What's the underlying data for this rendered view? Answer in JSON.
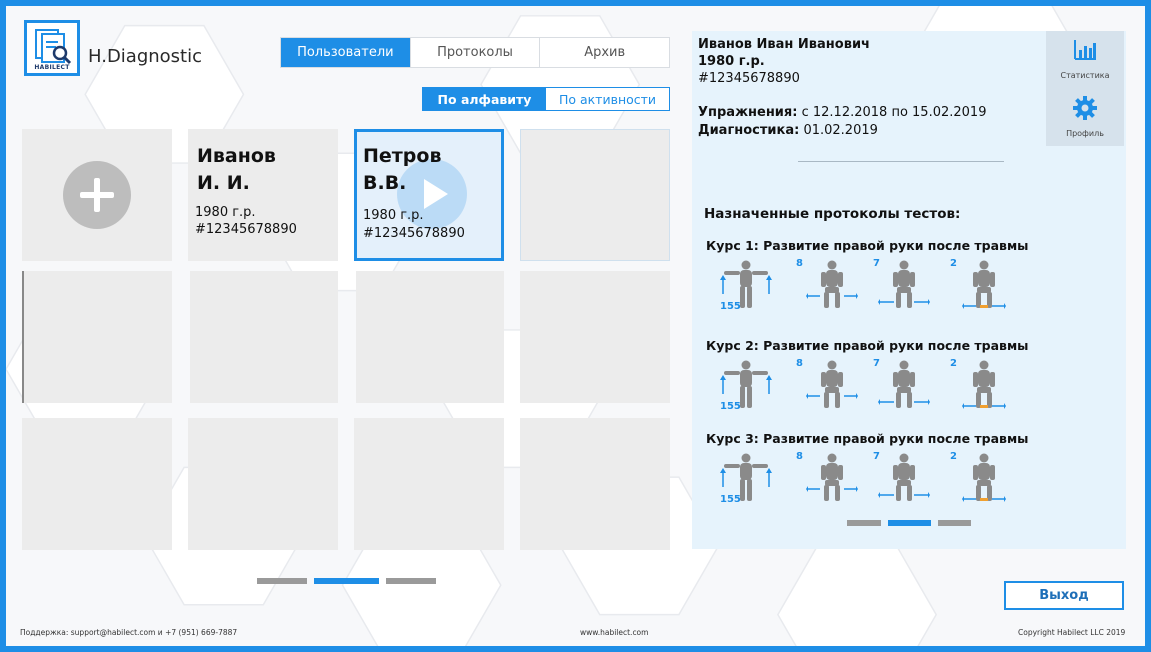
{
  "app": {
    "title": "H.Diagnostic",
    "logo_text": "HABILECT"
  },
  "tabs": [
    {
      "label": "Пользователи",
      "active": true
    },
    {
      "label": "Протоколы",
      "active": false
    },
    {
      "label": "Архив",
      "active": false
    }
  ],
  "sort": [
    {
      "label": "По алфавиту",
      "active": true
    },
    {
      "label": "По активности",
      "active": false
    }
  ],
  "users": [
    {
      "name_line1": "Иванов",
      "name_line2": "И. И.",
      "year": "1980  г.р.",
      "id": "#12345678890"
    },
    {
      "name_line1": "Петров",
      "name_line2": "В.В.",
      "year": "1980  г.р.",
      "id": "#12345678890"
    }
  ],
  "grid_pager": {
    "pages": 3,
    "current": 2
  },
  "patient": {
    "name": "Иванов Иван Иванович",
    "year": "1980 г.р.",
    "id": "#12345678890",
    "exercises_label": "Упражнения:",
    "exercises_value": " с 12.12.2018 по 15.02.2019",
    "diagnostics_label": "Диагностика:",
    "diagnostics_value": " 01.02.2019"
  },
  "side_buttons": [
    {
      "label": "Статистика",
      "icon": "bar-chart-icon"
    },
    {
      "label": "Профиль",
      "icon": "gear-icon"
    }
  ],
  "protocols_title": "Назначенные протоколы тестов:",
  "courses": [
    {
      "title": "Курс 1: Развитие правой руки после травмы",
      "values": [
        "155",
        "8",
        "7",
        "2"
      ]
    },
    {
      "title": "Курс 2: Развитие правой руки после травмы",
      "values": [
        "155",
        "8",
        "7",
        "2"
      ]
    },
    {
      "title": "Курс 3: Развитие правой руки после травмы",
      "values": [
        "155",
        "8",
        "7",
        "2"
      ]
    }
  ],
  "panel_pager": {
    "pages": 3,
    "current": 2
  },
  "exit_label": "Выход",
  "footer": {
    "support": "Поддержка: support@habilect.com и +7 (951) 669-7887",
    "site": "www.habilect.com",
    "copyright": "Copyright Habilect LLC 2019"
  },
  "colors": {
    "accent": "#1e8ee6",
    "card": "#ececec",
    "panel": "#e6f3fc"
  }
}
